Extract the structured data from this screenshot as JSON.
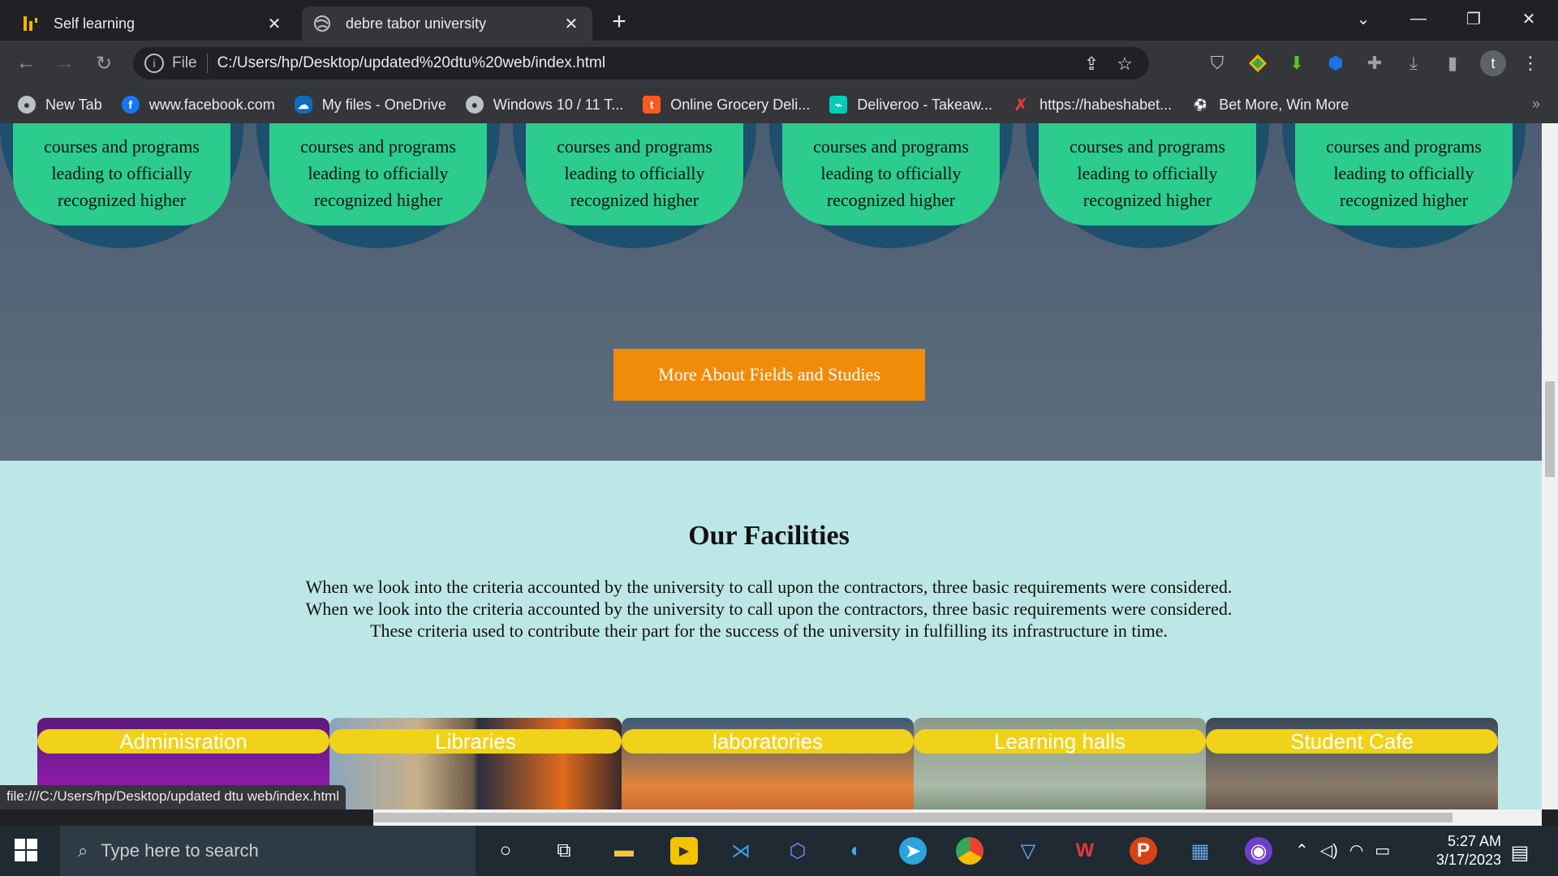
{
  "browser": {
    "tabs": [
      {
        "title": "Self learning"
      },
      {
        "title": "debre tabor university"
      }
    ],
    "address": {
      "scheme": "File",
      "url": "C:/Users/hp/Desktop/updated%20dtu%20web/index.html"
    },
    "profile_initial": "t",
    "bookmarks": [
      {
        "label": "New Tab"
      },
      {
        "label": "www.facebook.com"
      },
      {
        "label": "My files - OneDrive"
      },
      {
        "label": "Windows 10 / 11 T..."
      },
      {
        "label": "Online Grocery Deli..."
      },
      {
        "label": "Deliveroo - Takeaw..."
      },
      {
        "label": "https://habeshabet..."
      },
      {
        "label": "Bet More, Win More"
      }
    ],
    "status_url": "file:///C:/Users/hp/Desktop/updated dtu web/index.html"
  },
  "page": {
    "program_cards": [
      {
        "lines": [
          "courses and programs",
          "leading to officially",
          "recognized higher"
        ]
      },
      {
        "lines": [
          "courses and programs",
          "leading to officially",
          "recognized higher"
        ]
      },
      {
        "lines": [
          "courses and programs",
          "leading to officially",
          "recognized higher"
        ]
      },
      {
        "lines": [
          "courses and programs",
          "leading to officially",
          "recognized higher"
        ]
      },
      {
        "lines": [
          "courses and programs",
          "leading to officially",
          "recognized higher"
        ]
      },
      {
        "lines": [
          "courses and programs",
          "leading to officially",
          "recognized higher"
        ]
      }
    ],
    "more_button": "More About Fields and Studies",
    "facilities": {
      "title": "Our Facilities",
      "paragraph": [
        "When we look into the criteria accounted by the university to call upon the contractors, three basic requirements were considered.",
        "When we look into the criteria accounted by the university to call upon the contractors, three basic requirements were considered.",
        "These criteria used to contribute their part for the success of the university in fulfilling its infrastructure in time."
      ],
      "cards": [
        {
          "label": "Adminisration"
        },
        {
          "label": "Libraries"
        },
        {
          "label": "laboratories"
        },
        {
          "label": "Learning halls"
        },
        {
          "label": "Student Cafe"
        }
      ]
    },
    "colors": {
      "accent_button": "#f08c0a",
      "card_green": "#2bcc8e",
      "label_yellow": "#f0d21a",
      "section_bg": "#bde6e6"
    }
  },
  "taskbar": {
    "search_placeholder": "Type here to search",
    "time": "5:27 AM",
    "date": "3/17/2023"
  }
}
